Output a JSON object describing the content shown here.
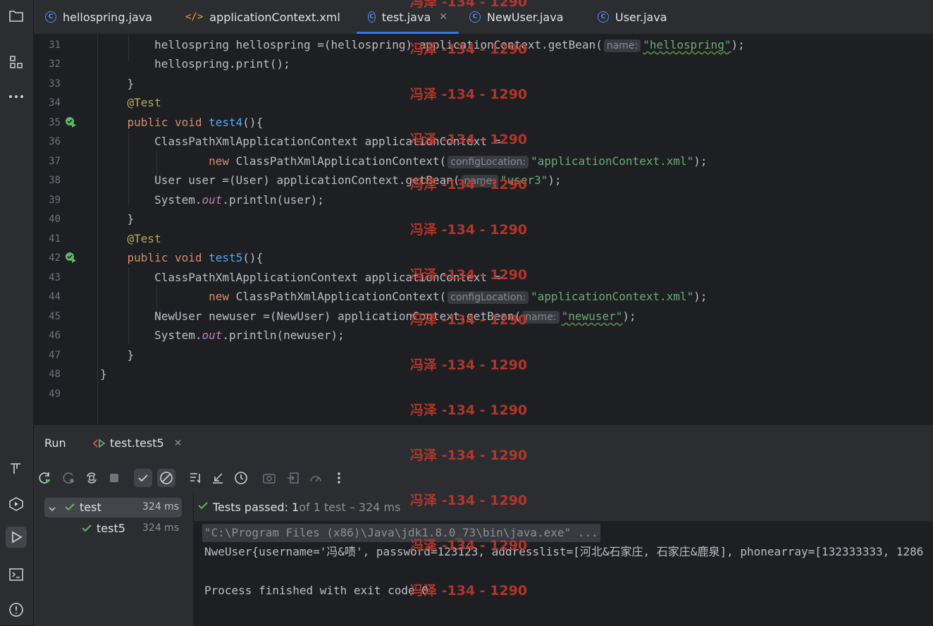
{
  "tabs": [
    {
      "label": "hellospring.java",
      "icon": "class-icon"
    },
    {
      "label": "applicationContext.xml",
      "icon": "xml-icon"
    },
    {
      "label": "test.java",
      "icon": "class-icon",
      "active": true
    },
    {
      "label": "NewUser.java",
      "icon": "class-icon"
    },
    {
      "label": "User.java",
      "icon": "class-icon"
    }
  ],
  "editor": {
    "line_numbers": [
      "31",
      "32",
      "33",
      "34",
      "35",
      "36",
      "37",
      "38",
      "39",
      "40",
      "41",
      "42",
      "43",
      "44",
      "45",
      "46",
      "47",
      "48",
      "49"
    ],
    "hints": {
      "name": "name:",
      "config": "configLocation:"
    },
    "strings": {
      "hellospring": "\"hellospring\"",
      "appctx": "\"applicationContext.xml\"",
      "user3": "\"user3\"",
      "newuser": "\"newuser\""
    },
    "lines": {
      "l31a": "        hellospring hellospring =(hellospring) applicationContext.getBean(",
      "l31b": ");",
      "l32": "        hellospring.print();",
      "l33": "    }",
      "l34": "    @Test",
      "l35kw": "    public void ",
      "l35fn": "test4",
      "l35end": "(){",
      "l36": "        ClassPathXmlApplicationContext applicationContext =",
      "l37kw": "                new ",
      "l37a": "ClassPathXmlApplicationContext(",
      "l37b": ");",
      "l38a": "        User user =(User) applicationContext.getBean(",
      "l38b": ");",
      "l39a": "        System.",
      "l39out": "out",
      "l39b": ".println(user);",
      "l40": "    }",
      "l41": "    @Test",
      "l42kw": "    public void ",
      "l42fn": "test5",
      "l42end": "(){",
      "l43": "        ClassPathXmlApplicationContext applicationContext =",
      "l44kw": "                new ",
      "l44a": "ClassPathXmlApplicationContext(",
      "l44b": ");",
      "l45a": "        NewUser newuser =(NewUser) applicationContext.getBean(",
      "l45b": ");",
      "l46a": "        System.",
      "l46out": "out",
      "l46b": ".println(newuser);",
      "l47": "    }",
      "l48": "}"
    }
  },
  "watermark": "冯泽 -134 - 1290",
  "run": {
    "title": "Run",
    "config_tab": "test.test5",
    "tree": [
      {
        "label": "test",
        "time": "324 ms"
      },
      {
        "label": "test5",
        "time": "324 ms"
      }
    ],
    "status_bold": "Tests passed: 1",
    "status_rest": " of 1 test – 324 ms",
    "console": [
      "\"C:\\Program Files (x86)\\Java\\jdk1.8.0_73\\bin\\java.exe\" ...",
      "NweUser{username='冯&啧', password=123123, addresslist=[河北&石家庄, 石家庄&鹿泉], phonearray=[132333333, 1286",
      "",
      "Process finished with exit code 0"
    ]
  },
  "colors": {
    "accent": "#3574f0",
    "pass": "#5fb865",
    "keyword": "#cf8e6d",
    "string": "#6aab73",
    "function": "#56a8f5",
    "annotation": "#b3ae60"
  }
}
